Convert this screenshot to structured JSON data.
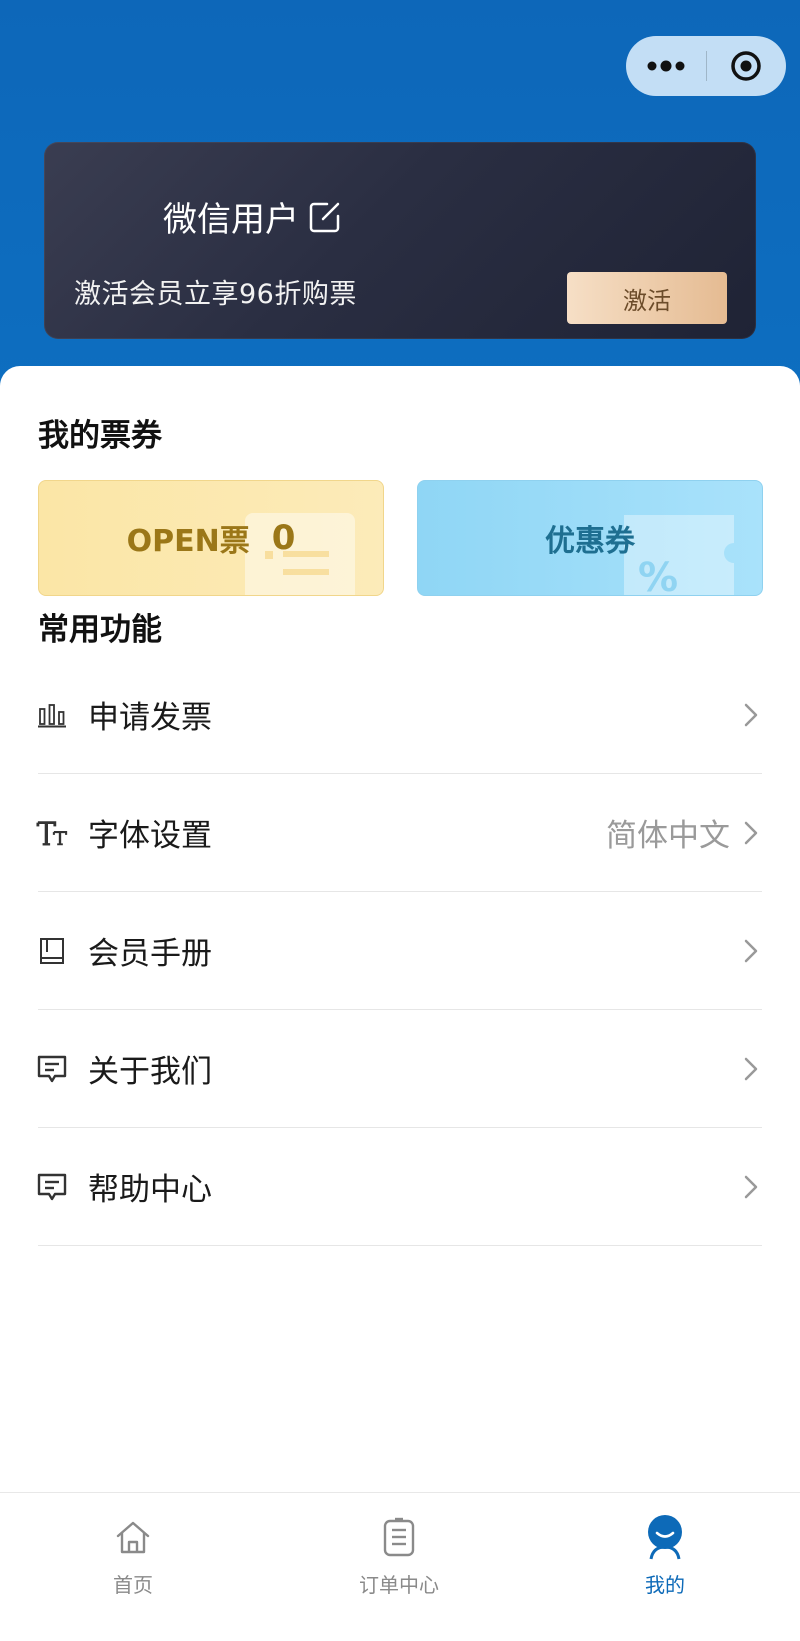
{
  "user": {
    "name": "微信用户",
    "promo_text": "激活会员立享96折购票",
    "activate_label": "激活"
  },
  "capsule": {
    "more_icon": "more-dots-icon",
    "close_icon": "target-circle-icon"
  },
  "tickets": {
    "title": "我的票券",
    "open_label": "OPEN票",
    "open_count": "0",
    "coupon_label": "优惠券"
  },
  "functions": {
    "title": "常用功能",
    "items": [
      {
        "label": "申请发票",
        "value": "",
        "icon": "bar-chart-icon"
      },
      {
        "label": "字体设置",
        "value": "简体中文",
        "icon": "font-size-icon"
      },
      {
        "label": "会员手册",
        "value": "",
        "icon": "book-icon"
      },
      {
        "label": "关于我们",
        "value": "",
        "icon": "message-icon"
      },
      {
        "label": "帮助中心",
        "value": "",
        "icon": "message-icon"
      }
    ]
  },
  "tabbar": {
    "items": [
      {
        "label": "首页",
        "icon": "home-icon"
      },
      {
        "label": "订单中心",
        "icon": "order-list-icon"
      },
      {
        "label": "我的",
        "icon": "profile-icon"
      }
    ]
  },
  "colors": {
    "header_blue": "#0d67b9",
    "active_tab": "#0d6ab8",
    "open_ticket_bg": "#fbe6a6",
    "coupon_bg": "#8fd6f5",
    "activate_btn": "#e5bb92"
  }
}
